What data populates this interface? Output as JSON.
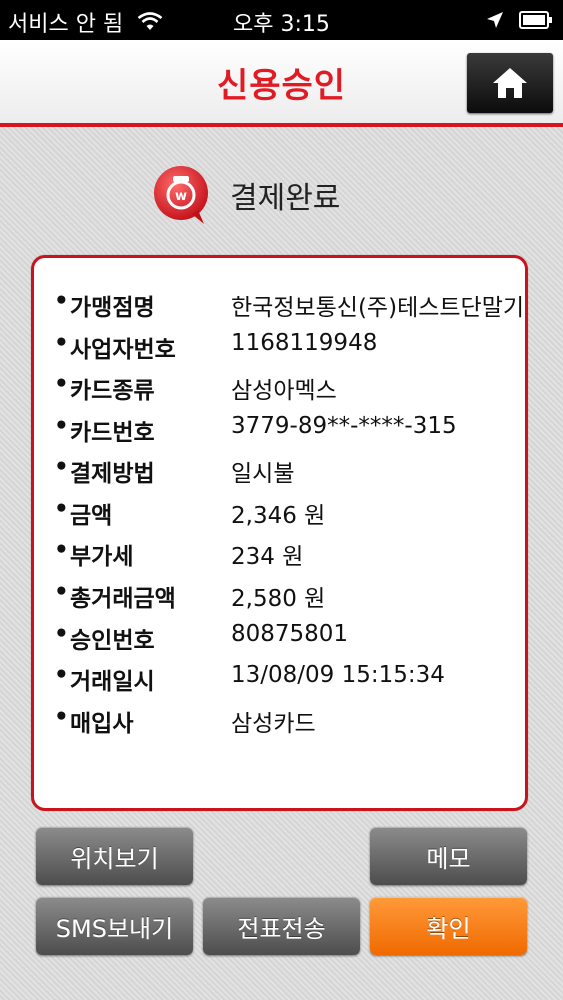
{
  "status_bar": {
    "carrier": "서비스 안 됨",
    "time": "오후 3:15",
    "icons": [
      "wifi-icon",
      "location-arrow-icon",
      "battery-icon"
    ]
  },
  "header": {
    "title": "신용승인",
    "home_icon": "home-icon"
  },
  "payment_status": {
    "text": "결제완료",
    "icon": "won-badge-icon"
  },
  "receipt": {
    "rows": [
      {
        "label": "가맹점명",
        "value": "한국정보통신(주)테스트단말기"
      },
      {
        "label": "사업자번호",
        "value": "1168119948"
      },
      {
        "label": "카드종류",
        "value": "삼성아멕스"
      },
      {
        "label": "카드번호",
        "value": "3779-89**-****-315"
      },
      {
        "label": "결제방법",
        "value": "일시불"
      },
      {
        "label": "금액",
        "value": "2,346 원"
      },
      {
        "label": "부가세",
        "value": "234 원"
      },
      {
        "label": "총거래금액",
        "value": "2,580 원"
      },
      {
        "label": "승인번호",
        "value": "80875801"
      },
      {
        "label": "거래일시",
        "value": "13/08/09 15:15:34"
      },
      {
        "label": "매입사",
        "value": "삼성카드"
      }
    ],
    "bullet": "•"
  },
  "buttons": {
    "location": "위치보기",
    "memo": "메모",
    "sms": "SMS보내기",
    "send_slip": "전표전송",
    "confirm": "확인"
  },
  "colors": {
    "accent_red": "#e01b23",
    "confirm_orange": "#f07a10",
    "button_gray": "#6b6b6b"
  }
}
